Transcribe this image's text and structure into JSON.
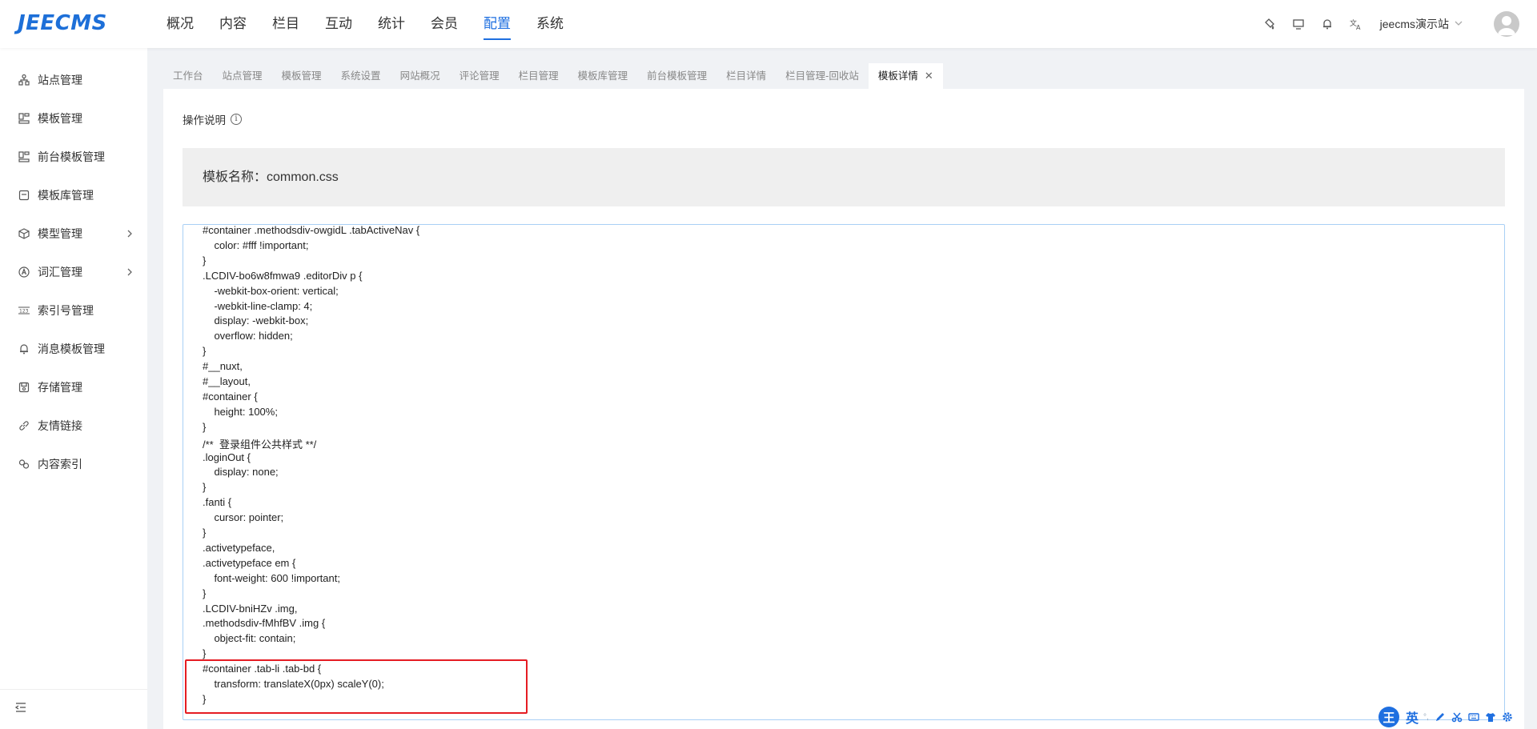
{
  "header": {
    "logo": "JEECMS",
    "nav": [
      "概况",
      "内容",
      "栏目",
      "互动",
      "统计",
      "会员",
      "配置",
      "系统"
    ],
    "active_nav": "配置",
    "site_name": "jeecms演示站",
    "icons": [
      "clear-icon",
      "monitor-icon",
      "bell-icon",
      "translate-icon"
    ]
  },
  "sidebar": {
    "items": [
      {
        "label": "站点管理",
        "icon": "site-icon"
      },
      {
        "label": "模板管理",
        "icon": "template-icon"
      },
      {
        "label": "前台模板管理",
        "icon": "template-icon"
      },
      {
        "label": "模板库管理",
        "icon": "library-icon"
      },
      {
        "label": "模型管理",
        "icon": "model-icon",
        "expandable": true
      },
      {
        "label": "词汇管理",
        "icon": "vocab-icon",
        "expandable": true
      },
      {
        "label": "索引号管理",
        "icon": "index-icon"
      },
      {
        "label": "消息模板管理",
        "icon": "bell-icon"
      },
      {
        "label": "存储管理",
        "icon": "storage-icon"
      },
      {
        "label": "友情链接",
        "icon": "link-icon"
      },
      {
        "label": "内容索引",
        "icon": "content-index-icon"
      }
    ]
  },
  "tabs": [
    {
      "label": "工作台"
    },
    {
      "label": "站点管理"
    },
    {
      "label": "模板管理"
    },
    {
      "label": "系统设置"
    },
    {
      "label": "网站概况"
    },
    {
      "label": "评论管理"
    },
    {
      "label": "栏目管理"
    },
    {
      "label": "模板库管理"
    },
    {
      "label": "前台模板管理"
    },
    {
      "label": "栏目详情"
    },
    {
      "label": "栏目管理-回收站"
    },
    {
      "label": "模板详情",
      "active": true
    }
  ],
  "main": {
    "op_label": "操作说明",
    "template_name": "模板名称：common.css",
    "code_lines": [
      "#container .methodsdiv-owgidL .tabActiveNav {",
      "    color: #fff !important;",
      "}",
      ".LCDIV-bo6w8fmwa9 .editorDiv p {",
      "    -webkit-box-orient: vertical;",
      "    -webkit-line-clamp: 4;",
      "    display: -webkit-box;",
      "    overflow: hidden;",
      "}",
      "#__nuxt,",
      "#__layout,",
      "#container {",
      "    height: 100%;",
      "}",
      "/**  登录组件公共样式 **/",
      ".loginOut {",
      "    display: none;",
      "}",
      ".fanti {",
      "    cursor: pointer;",
      "}",
      ".activetypeface,",
      ".activetypeface em {",
      "    font-weight: 600 !important;",
      "}",
      ".LCDIV-bniHZv .img,",
      ".methodsdiv-fMhfBV .img {",
      "    object-fit: contain;",
      "}",
      "#container .tab-li .tab-bd {",
      "    transform: translateX(0px) scaleY(0);",
      "}"
    ]
  },
  "ime": {
    "logo": "王",
    "mode": "英",
    "dot": "°,"
  }
}
